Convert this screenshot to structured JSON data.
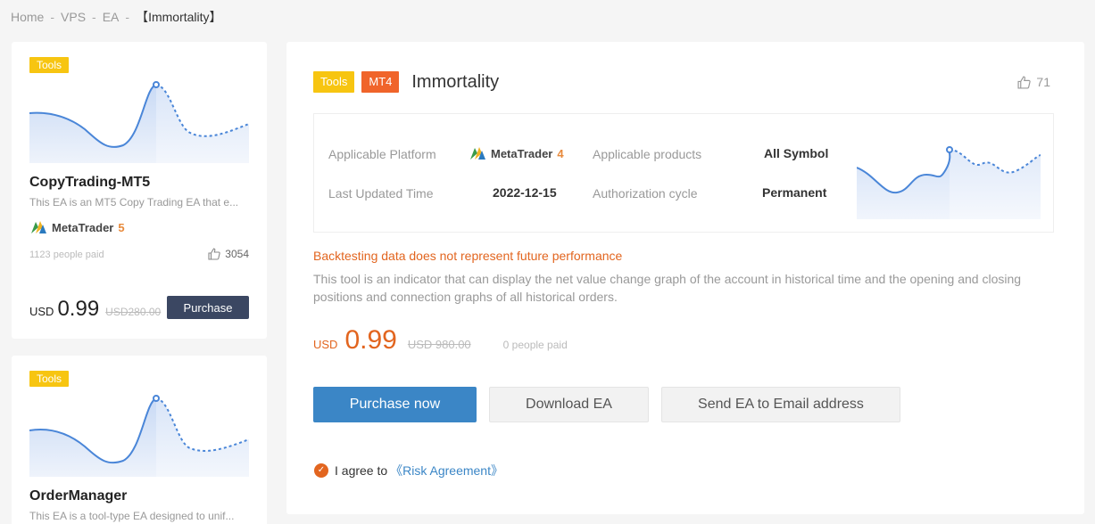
{
  "breadcrumb": {
    "items": [
      "Home",
      "VPS",
      "EA"
    ],
    "current": "【Immortality】",
    "separator": "-"
  },
  "sidebar": {
    "cards": [
      {
        "tag": "Tools",
        "name": "CopyTrading-MT5",
        "description": "This EA is an MT5 Copy Trading EA that e...",
        "platform": {
          "brand": "MetaTrader",
          "version": "5"
        },
        "paid": "1123 people paid",
        "likes": "3054",
        "currency": "USD",
        "price": "0.99",
        "old_price": "USD280.00",
        "purchase_label": "Purchase"
      },
      {
        "tag": "Tools",
        "name": "OrderManager",
        "description": "This EA is a tool-type EA designed to unif..."
      }
    ]
  },
  "detail": {
    "tags": [
      "Tools",
      "MT4"
    ],
    "title": "Immortality",
    "likes": "71",
    "info": {
      "platform_label": "Applicable Platform",
      "platform": {
        "brand": "MetaTrader",
        "version": "4"
      },
      "updated_label": "Last Updated Time",
      "updated": "2022-12-15",
      "products_label": "Applicable products",
      "products": "All Symbol",
      "auth_label": "Authorization cycle",
      "auth": "Permanent"
    },
    "warning": "Backtesting data does not represent future performance",
    "intro": "This tool is an indicator that can display the net value change graph of the account in historical time and the opening and closing positions and connection graphs of all historical orders.",
    "currency": "USD",
    "price": "0.99",
    "old_price": "USD 980.00",
    "paid": "0 people paid",
    "buttons": {
      "purchase": "Purchase now",
      "download": "Download EA",
      "send": "Send EA to Email address"
    },
    "agree_text": "I agree to",
    "agree_link": "《Risk Agreement》"
  },
  "colors": {
    "tag_tools": "#f7c511",
    "tag_mt4": "#f0642a",
    "accent_orange": "#e2651f",
    "primary_blue": "#3b86c6",
    "dark_button": "#3b4762",
    "spark_line": "#4a86d8"
  }
}
